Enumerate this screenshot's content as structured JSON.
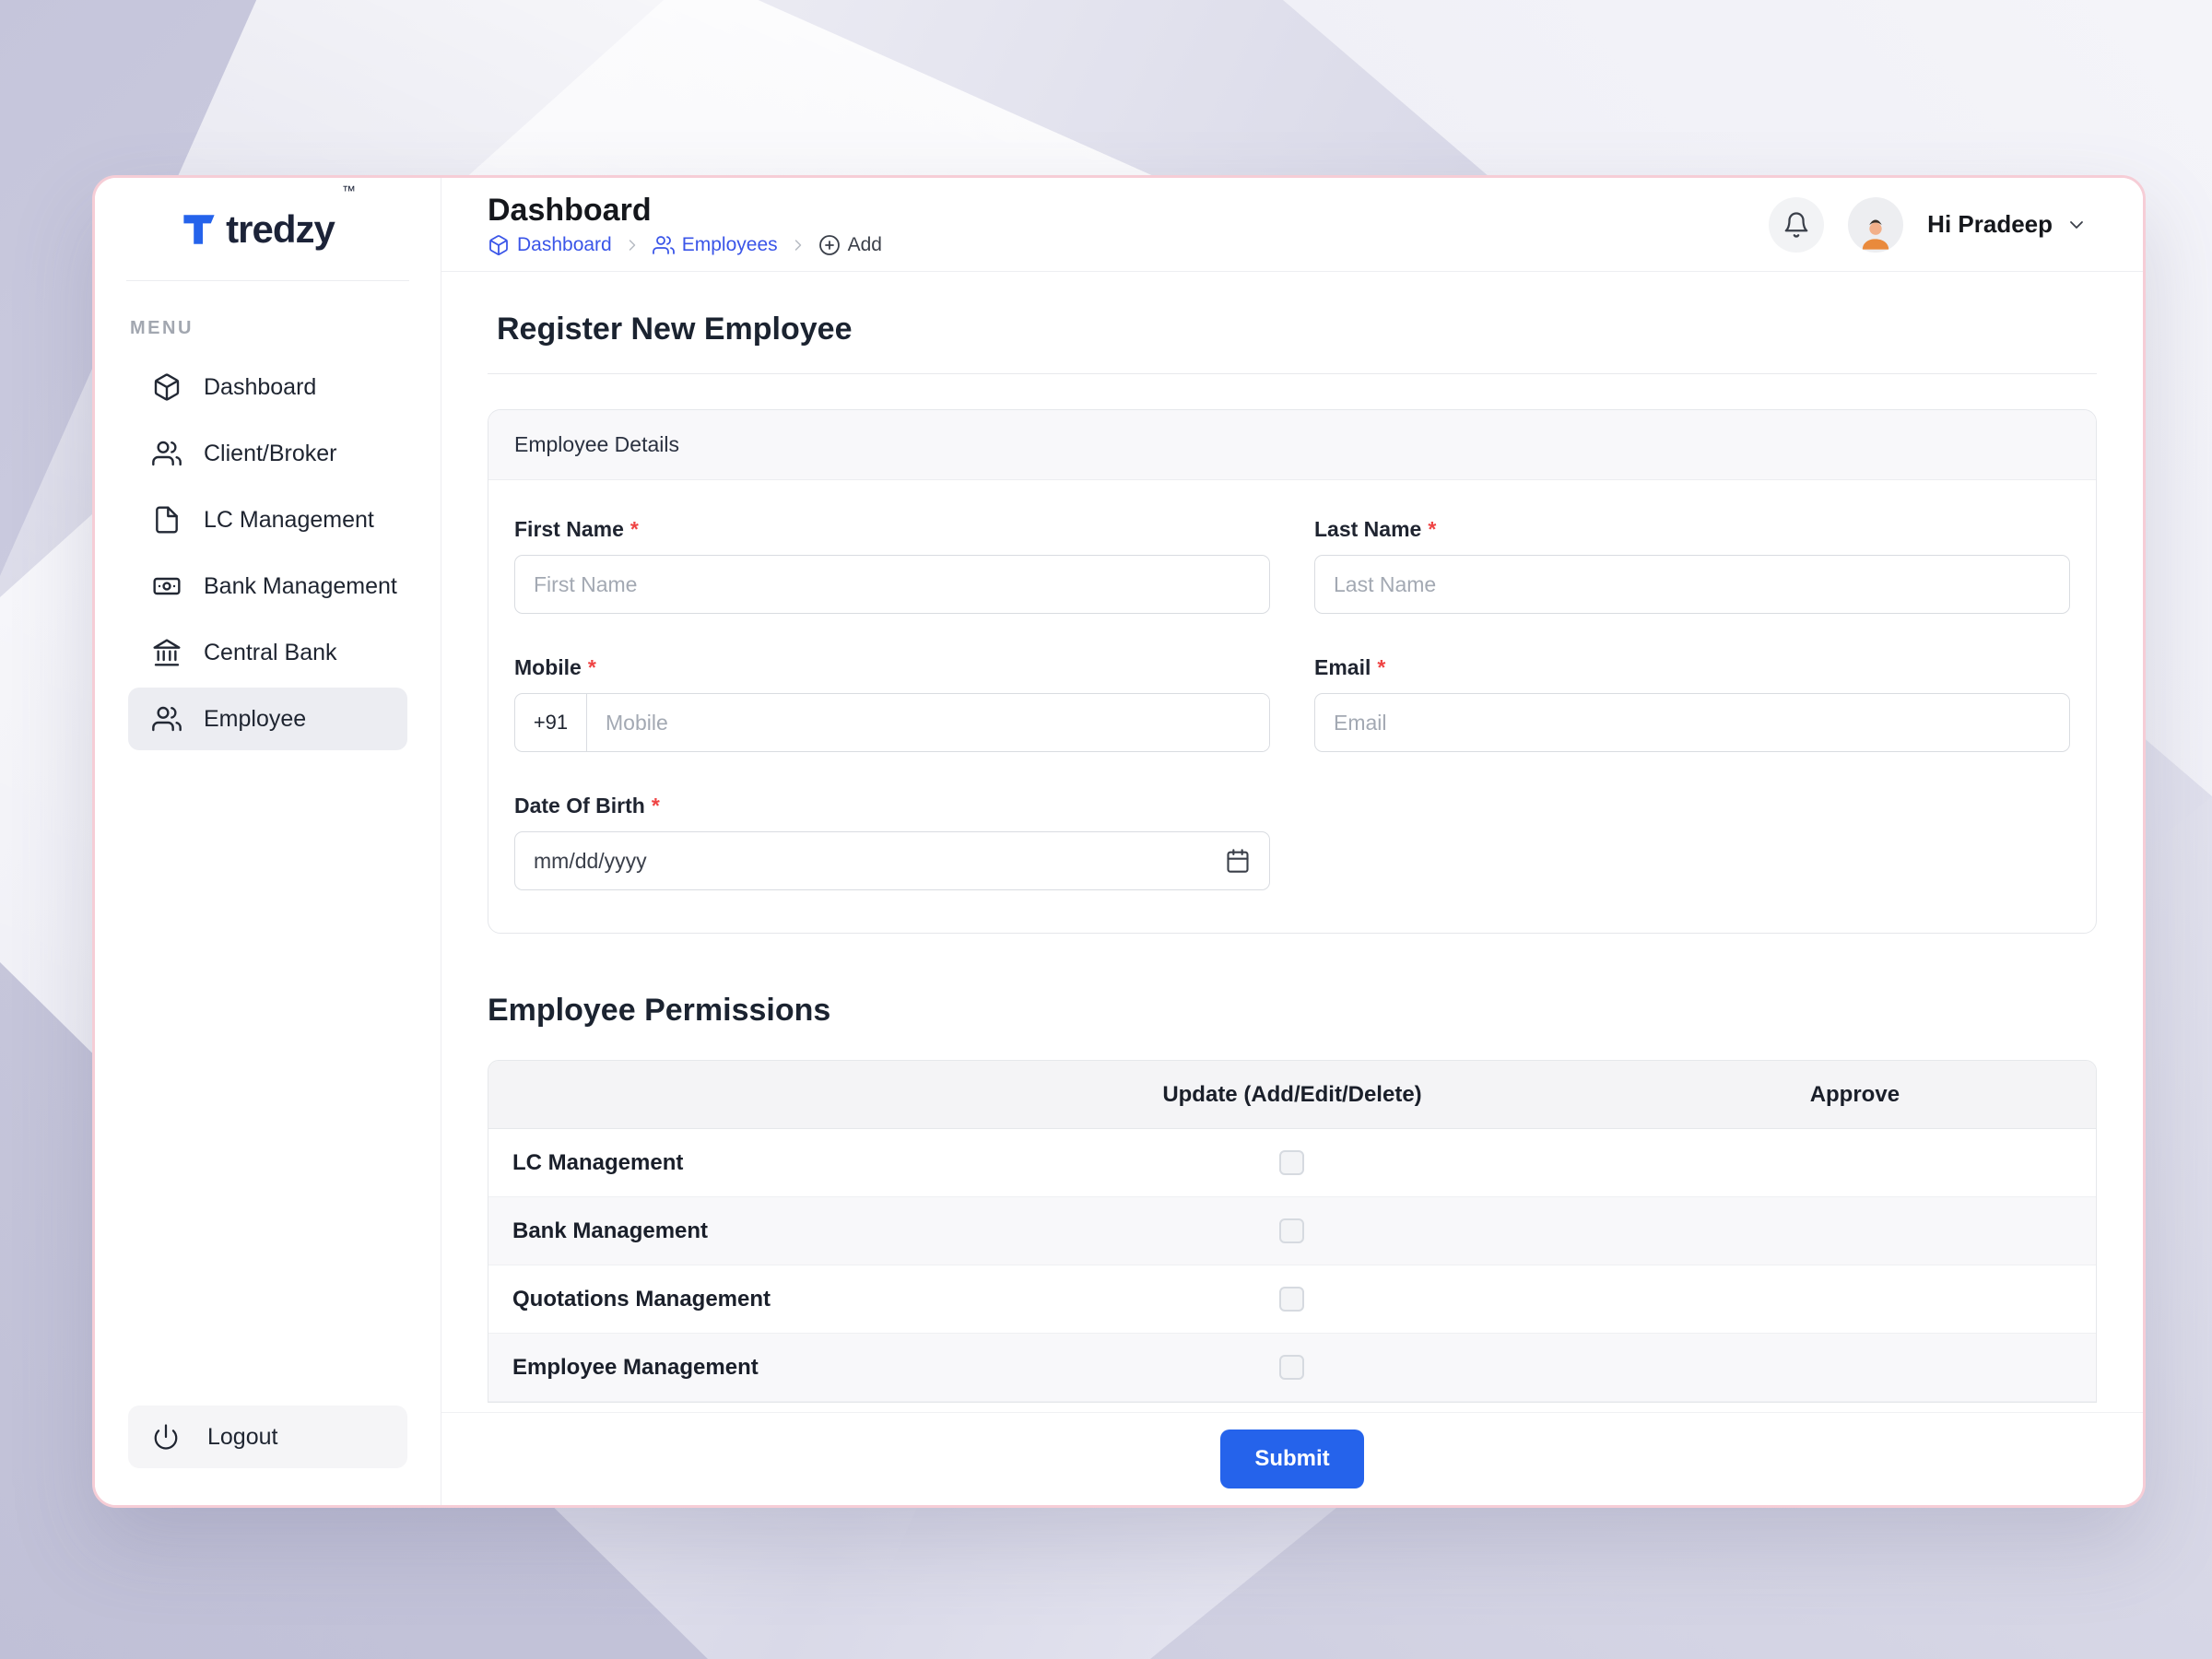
{
  "colors": {
    "accent": "#2563EB",
    "link": "#3A55E8",
    "required": "#EF4444",
    "window_border": "#F6CDD6"
  },
  "brand": {
    "name": "tredzy",
    "trademark": "™"
  },
  "sidebar": {
    "section_label": "MENU",
    "items": [
      {
        "label": "Dashboard",
        "icon": "cube-icon"
      },
      {
        "label": "Client/Broker",
        "icon": "users-icon"
      },
      {
        "label": "LC Management",
        "icon": "file-icon"
      },
      {
        "label": "Bank Management",
        "icon": "banknote-icon"
      },
      {
        "label": "Central Bank",
        "icon": "bank-icon"
      },
      {
        "label": "Employee",
        "icon": "users-icon"
      }
    ],
    "logout": "Logout"
  },
  "header": {
    "title": "Dashboard",
    "breadcrumb": [
      {
        "label": "Dashboard",
        "icon": "cube-icon"
      },
      {
        "label": "Employees",
        "icon": "users-icon"
      },
      {
        "label": "Add",
        "icon": "plus-circle-icon"
      }
    ],
    "greeting": "Hi Pradeep"
  },
  "page": {
    "title": "Register New Employee"
  },
  "details": {
    "card_title": "Employee Details",
    "required_marker": "*",
    "fields": {
      "first_name": {
        "label": "First Name",
        "placeholder": "First Name"
      },
      "last_name": {
        "label": "Last Name",
        "placeholder": "Last Name"
      },
      "mobile": {
        "label": "Mobile",
        "prefix": "+91",
        "placeholder": "Mobile"
      },
      "email": {
        "label": "Email",
        "placeholder": "Email"
      },
      "dob": {
        "label": "Date Of Birth",
        "value": "mm/dd/yyyy"
      }
    }
  },
  "permissions": {
    "title": "Employee Permissions",
    "columns": {
      "update": "Update (Add/Edit/Delete)",
      "approve": "Approve"
    },
    "rows": [
      {
        "label": "LC Management",
        "update_checked": false
      },
      {
        "label": "Bank Management",
        "update_checked": false
      },
      {
        "label": "Quotations Management",
        "update_checked": false
      },
      {
        "label": "Employee Management",
        "update_checked": false
      }
    ]
  },
  "footer": {
    "submit": "Submit"
  }
}
